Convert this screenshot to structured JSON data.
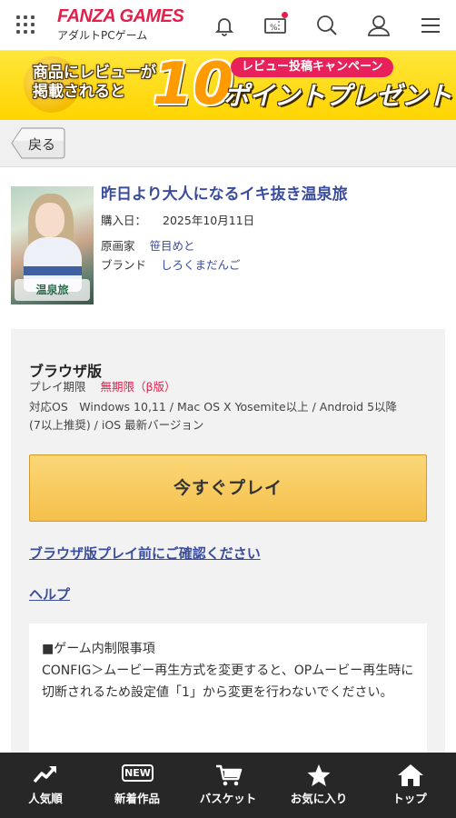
{
  "header": {
    "logo_main": "FANZA GAMES",
    "logo_sub": "アダルトPCゲーム",
    "icons": [
      "grid-menu-icon",
      "bell-icon",
      "coupon-icon",
      "search-icon",
      "user-icon",
      "hamburger-icon"
    ]
  },
  "banner": {
    "left_line1": "商品にレビューが",
    "left_line2": "掲載されると",
    "big_number": "10",
    "pill": "レビュー投稿キャンペーン",
    "right_text": "ポイントプレゼント"
  },
  "back_button": {
    "label": "戻る"
  },
  "product": {
    "title": "昨日より大人になるイキ抜き温泉旅",
    "thumb_text": "温泉旅",
    "purchase_label": "購入日：",
    "purchase_date": "2025年10月11日",
    "artist_label": "原画家",
    "artist": "笹目めと",
    "brand_label": "ブランド",
    "brand": "しろくまだんご"
  },
  "play_card": {
    "title": "ブラウザ版",
    "period_label": "プレイ期限",
    "period_value": "無期限（β版）",
    "os_line1": "対応OS　Windows 10,11 / Mac OS X Yosemite以上 / Android 5以降",
    "os_line2": "(7以上推奨) / iOS 最新バージョン",
    "play_button": "今すぐプレイ",
    "confirm_link": "ブラウザ版プレイ前にご確認ください",
    "help_link": "ヘルプ",
    "notes_heading": "■ゲーム内制限事項",
    "notes_body": "CONFIG＞ムービー再生方式を変更すると、OPムービー再生時に切断されるため設定値「1」から変更を行わないでください。"
  },
  "bottom_nav": [
    {
      "label": "人気順",
      "icon": "trend-icon"
    },
    {
      "label": "新着作品",
      "icon": "new-icon",
      "badge": "NEW"
    },
    {
      "label": "バスケット",
      "icon": "basket-icon"
    },
    {
      "label": "お気に入り",
      "icon": "star-icon"
    },
    {
      "label": "トップ",
      "icon": "home-icon"
    }
  ],
  "colors": {
    "brand": "#e3204c",
    "link": "#3a4d9c",
    "play_button": "#f5c04b",
    "nav_bg": "#272727"
  }
}
